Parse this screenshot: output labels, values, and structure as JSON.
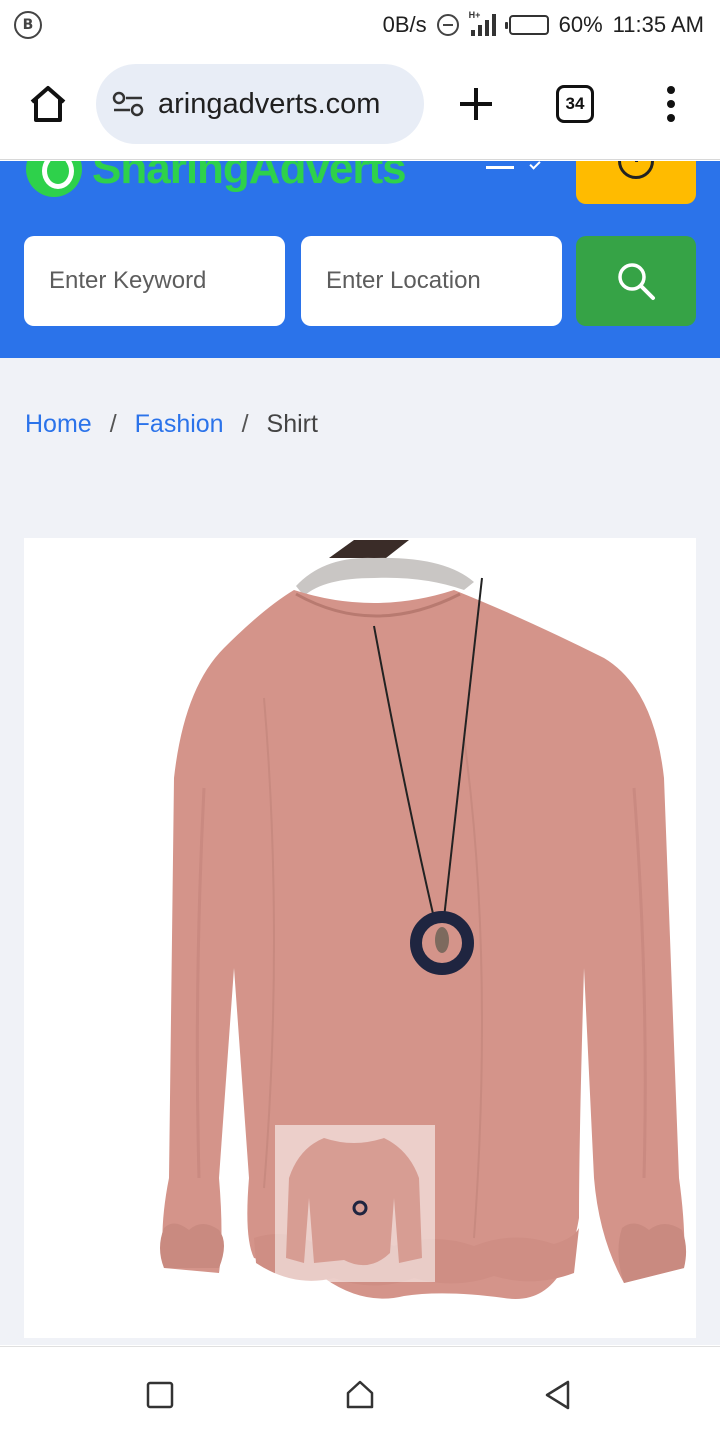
{
  "status_bar": {
    "left_badge": "B",
    "network_speed": "0B/s",
    "network_type": "H+",
    "battery_percent": "60%",
    "battery_level": 0.6,
    "time": "11:35 AM"
  },
  "browser": {
    "url": "aringadverts.com",
    "tab_count": "34",
    "icons": [
      "home-icon",
      "site-settings-icon",
      "new-tab-icon",
      "tab-switcher-icon",
      "menu-icon"
    ]
  },
  "site_header": {
    "logo_text": "SharingAdverts",
    "search": {
      "keyword_placeholder": "Enter Keyword",
      "location_placeholder": "Enter Location"
    },
    "colors": {
      "header_bg": "#2b73ea",
      "logo_green": "#2ed14b",
      "post_ad_yellow": "#ffbb00",
      "search_green": "#36a346"
    }
  },
  "breadcrumb": {
    "home": "Home",
    "category": "Fashion",
    "current": "Shirt",
    "separator": "/"
  },
  "product": {
    "image": "pink-long-sleeve-ruffle-blouse-with-pendant-necklace",
    "shirt_color": "#d4948a"
  },
  "system_nav": {
    "icons": [
      "recents-square-icon",
      "home-circle-icon",
      "back-triangle-icon"
    ]
  }
}
